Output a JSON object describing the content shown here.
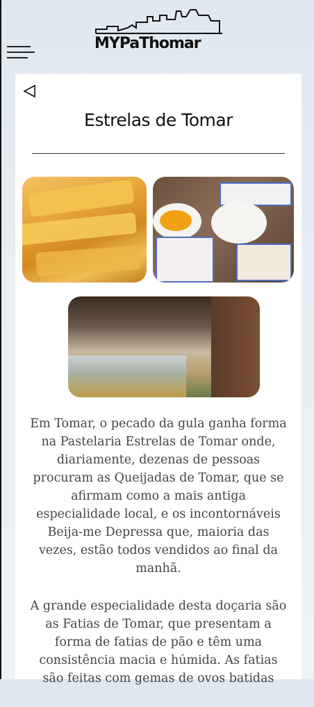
{
  "header": {
    "logo_text": "MYPaThomar",
    "logo_alt": "MY PaThomar logo"
  },
  "icons": {
    "menu": "hamburger-icon",
    "back": "back-triangle-icon"
  },
  "article": {
    "title": "Estrelas de Tomar",
    "paragraphs": [
      "Em Tomar, o pecado da gula ganha forma na Pastelaria Estrelas de Tomar onde, diariamente, dezenas de pessoas procuram as Queijadas de Tomar, que se afirmam como a mais antiga especialidade local, e os incontornáveis Beija-me Depressa que, maioria das vezes, estão todos vendidos ao final da manhã.",
      "A grande especialidade desta doçaria são as Fatias de Tomar, que presentam a forma de fatias de pão e têm uma consistência macia e húmida. As fatias são feitas com gemas de ovos batidas"
    ]
  },
  "colors": {
    "text": "#444444",
    "title": "#111111",
    "panel": "#ffffff"
  }
}
